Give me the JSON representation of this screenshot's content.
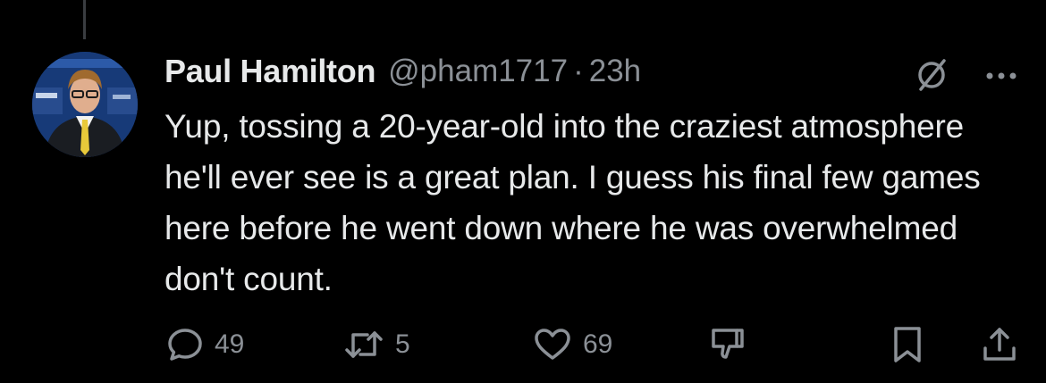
{
  "tweet": {
    "display_name": "Paul Hamilton",
    "handle": "@pham1717",
    "separator": "·",
    "time": "23h",
    "text": "Yup, tossing a 20-year-old into the craziest atmosphere he'll ever see is a great plan. I guess his final few games here before he went down where he was overwhelmed don't count."
  },
  "header_icons": [
    "grok-icon",
    "more-icon"
  ],
  "actions": {
    "replies": "49",
    "reposts": "5",
    "likes": "69",
    "icons": [
      "reply-icon",
      "repost-icon",
      "like-icon",
      "dislike-icon",
      "bookmark-icon",
      "share-icon"
    ]
  },
  "colors": {
    "background": "#000000",
    "primary_text": "#e7e9ea",
    "secondary_text": "#8b9096",
    "thread_line": "#3a3d41"
  }
}
